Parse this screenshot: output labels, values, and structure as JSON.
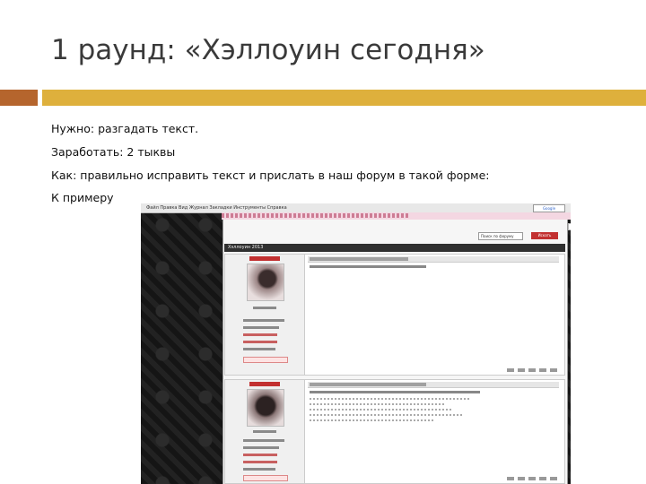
{
  "slide": {
    "title": "1 раунд: «Хэллоуин сегодня»",
    "lines": [
      "Нужно: разгадать текст.",
      "Заработать: 2 тыквы",
      "Как: правильно исправить текст и прислать в наш форум в такой форме:",
      "К примеру"
    ]
  },
  "colors": {
    "accent_left": "#b5652d",
    "accent_right": "#deb03c",
    "forum_red": "#c23030"
  },
  "screenshot": {
    "browser_menu": "Файл Правка Вид Журнал Закладки Инструменты Справка",
    "browser_search": "Google",
    "forum_search_placeholder": "Поиск по форуму",
    "forum_search_button": "Искать",
    "topic_title": "Хэллоуин 2013"
  }
}
